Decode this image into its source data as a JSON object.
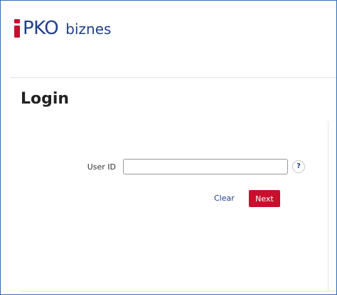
{
  "brand": {
    "pko": "PKO",
    "product": "biznes"
  },
  "page": {
    "title": "Login"
  },
  "form": {
    "user_id_label": "User ID",
    "user_id_value": "",
    "help_glyph": "?",
    "clear_label": "Clear",
    "next_label": "Next"
  },
  "colors": {
    "brand_red": "#c8102e",
    "brand_blue": "#1f3f8a",
    "frame_border": "#2f6fb3"
  },
  "icons": {
    "logo_mark": "pko-i-logo-icon",
    "help": "question-mark-icon"
  }
}
